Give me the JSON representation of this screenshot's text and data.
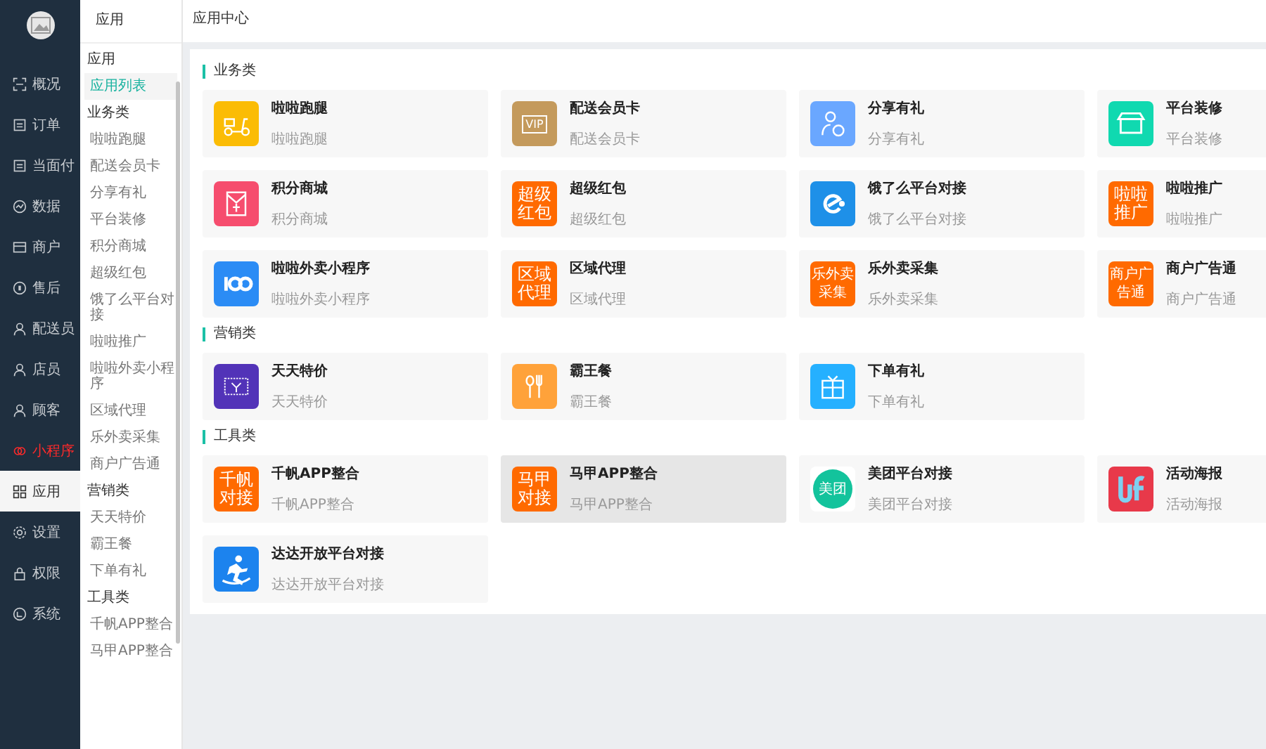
{
  "nav": {
    "items": [
      {
        "label": "概况",
        "selected": false,
        "highlighted": false
      },
      {
        "label": "订单",
        "selected": false,
        "highlighted": false
      },
      {
        "label": "当面付",
        "selected": false,
        "highlighted": false
      },
      {
        "label": "数据",
        "selected": false,
        "highlighted": false
      },
      {
        "label": "商户",
        "selected": false,
        "highlighted": false
      },
      {
        "label": "售后",
        "selected": false,
        "highlighted": false
      },
      {
        "label": "配送员",
        "selected": false,
        "highlighted": false
      },
      {
        "label": "店员",
        "selected": false,
        "highlighted": false
      },
      {
        "label": "顾客",
        "selected": false,
        "highlighted": false
      },
      {
        "label": "小程序",
        "selected": false,
        "highlighted": true
      },
      {
        "label": "应用",
        "selected": true,
        "highlighted": false
      },
      {
        "label": "设置",
        "selected": false,
        "highlighted": false
      },
      {
        "label": "权限",
        "selected": false,
        "highlighted": false
      },
      {
        "label": "系统",
        "selected": false,
        "highlighted": false
      }
    ]
  },
  "submenu": {
    "title": "应用",
    "groups": [
      {
        "heading": "应用",
        "items": [
          {
            "label": "应用列表",
            "selected": true
          }
        ]
      },
      {
        "heading": "业务类",
        "items": [
          {
            "label": "啦啦跑腿",
            "selected": false
          },
          {
            "label": "配送会员卡",
            "selected": false
          },
          {
            "label": "分享有礼",
            "selected": false
          },
          {
            "label": "平台装修",
            "selected": false
          },
          {
            "label": "积分商城",
            "selected": false
          },
          {
            "label": "超级红包",
            "selected": false
          },
          {
            "label": "饿了么平台对接",
            "selected": false
          },
          {
            "label": "啦啦推广",
            "selected": false
          },
          {
            "label": "啦啦外卖小程序",
            "selected": false
          },
          {
            "label": "区域代理",
            "selected": false
          },
          {
            "label": "乐外卖采集",
            "selected": false
          },
          {
            "label": "商户广告通",
            "selected": false
          }
        ]
      },
      {
        "heading": "营销类",
        "items": [
          {
            "label": "天天特价",
            "selected": false
          },
          {
            "label": "霸王餐",
            "selected": false
          },
          {
            "label": "下单有礼",
            "selected": false
          }
        ]
      },
      {
        "heading": "工具类",
        "items": [
          {
            "label": "千帆APP整合",
            "selected": false
          },
          {
            "label": "马甲APP整合",
            "selected": false
          }
        ]
      }
    ]
  },
  "page_title": "应用中心",
  "sections": [
    {
      "title": "业务类",
      "apps": [
        {
          "name": "啦啦跑腿",
          "desc": "啦啦跑腿",
          "kind": "picture",
          "color": "#fbbc05",
          "hovered": false
        },
        {
          "name": "配送会员卡",
          "desc": "配送会员卡",
          "kind": "tag",
          "icon_text": "VIP",
          "color": "#c49a5c",
          "hovered": false
        },
        {
          "name": "分享有礼",
          "desc": "分享有礼",
          "kind": "picture",
          "color": "#6aa7ff",
          "hovered": false
        },
        {
          "name": "平台装修",
          "desc": "平台装修",
          "kind": "picture",
          "color": "#10d9b0",
          "hovered": false
        },
        {
          "name": "积分商城",
          "desc": "积分商城",
          "kind": "picture",
          "color": "#f64d6e",
          "hovered": false
        },
        {
          "name": "超级红包",
          "desc": "超级红包",
          "kind": "text",
          "icon_text": "超级红包",
          "color": "#ff6a00",
          "hovered": false
        },
        {
          "name": "饿了么平台对接",
          "desc": "饿了么平台对接",
          "kind": "picture",
          "color": "#1e90e8",
          "hovered": false
        },
        {
          "name": "啦啦推广",
          "desc": "啦啦推广",
          "kind": "text",
          "icon_text": "啦啦推广",
          "color": "#ff6a00",
          "hovered": false
        },
        {
          "name": "啦啦外卖小程序",
          "desc": "啦啦外卖小程序",
          "kind": "picture",
          "color": "#2b8cf5",
          "hovered": false
        },
        {
          "name": "区域代理",
          "desc": "区域代理",
          "kind": "text",
          "icon_text": "区域代理",
          "color": "#ff6a00",
          "hovered": false
        },
        {
          "name": "乐外卖采集",
          "desc": "乐外卖采集",
          "kind": "text",
          "icon_text": "乐外卖采集",
          "color": "#ff6a00",
          "hovered": false
        },
        {
          "name": "商户广告通",
          "desc": "商户广告通",
          "kind": "text",
          "icon_text": "商户广告通",
          "color": "#ff6a00",
          "hovered": false
        }
      ]
    },
    {
      "title": "营销类",
      "apps": [
        {
          "name": "天天特价",
          "desc": "天天特价",
          "kind": "picture",
          "color": "#5233b8",
          "hovered": false
        },
        {
          "name": "霸王餐",
          "desc": "霸王餐",
          "kind": "picture",
          "color": "#ffa23a",
          "hovered": false
        },
        {
          "name": "下单有礼",
          "desc": "下单有礼",
          "kind": "picture",
          "color": "#25b0ff",
          "hovered": false
        }
      ]
    },
    {
      "title": "工具类",
      "apps": [
        {
          "name": "千帆APP整合",
          "desc": "千帆APP整合",
          "kind": "text",
          "icon_text": "千帆对接",
          "color": "#ff6a00",
          "hovered": false
        },
        {
          "name": "马甲APP整合",
          "desc": "马甲APP整合",
          "kind": "text",
          "icon_text": "马甲对接",
          "color": "#ff6a00",
          "hovered": true
        },
        {
          "name": "美团平台对接",
          "desc": "美团平台对接",
          "kind": "round",
          "icon_text": "美团",
          "color": "#13c39c",
          "hovered": false
        },
        {
          "name": "活动海报",
          "desc": "活动海报",
          "kind": "picture",
          "color": "#e8394a",
          "hovered": false
        },
        {
          "name": "达达开放平台对接",
          "desc": "达达开放平台对接",
          "kind": "picture",
          "color": "#1c83ee",
          "hovered": false
        }
      ]
    }
  ]
}
